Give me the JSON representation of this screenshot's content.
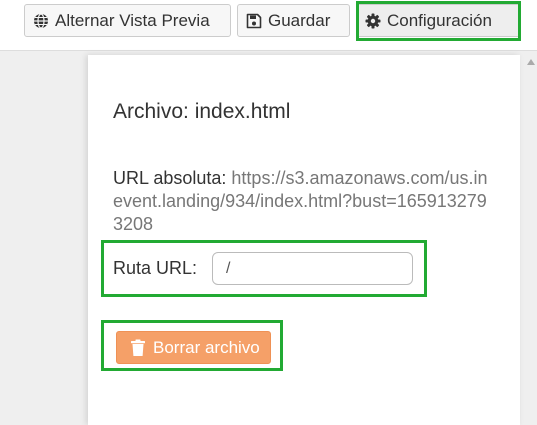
{
  "toolbar": {
    "preview_label": "Alternar Vista Previa",
    "save_label": "Guardar",
    "settings_label": "Configuración"
  },
  "panel": {
    "file_title": "Archivo: index.html",
    "absolute_url_label": "URL absoluta:",
    "absolute_url_value": "https://s3.amazonaws.com/us.inevent.landing/934/index.html?bust=1659132793208",
    "route_label": "Ruta URL:",
    "route_value": "/",
    "delete_label": "Borrar archivo"
  },
  "icons": {
    "preview": "globe-icon",
    "save": "floppy-disk-icon",
    "settings": "gear-icon",
    "delete": "trash-icon"
  },
  "colors": {
    "highlight": "#22aa33",
    "delete_button": "#f5a068"
  }
}
